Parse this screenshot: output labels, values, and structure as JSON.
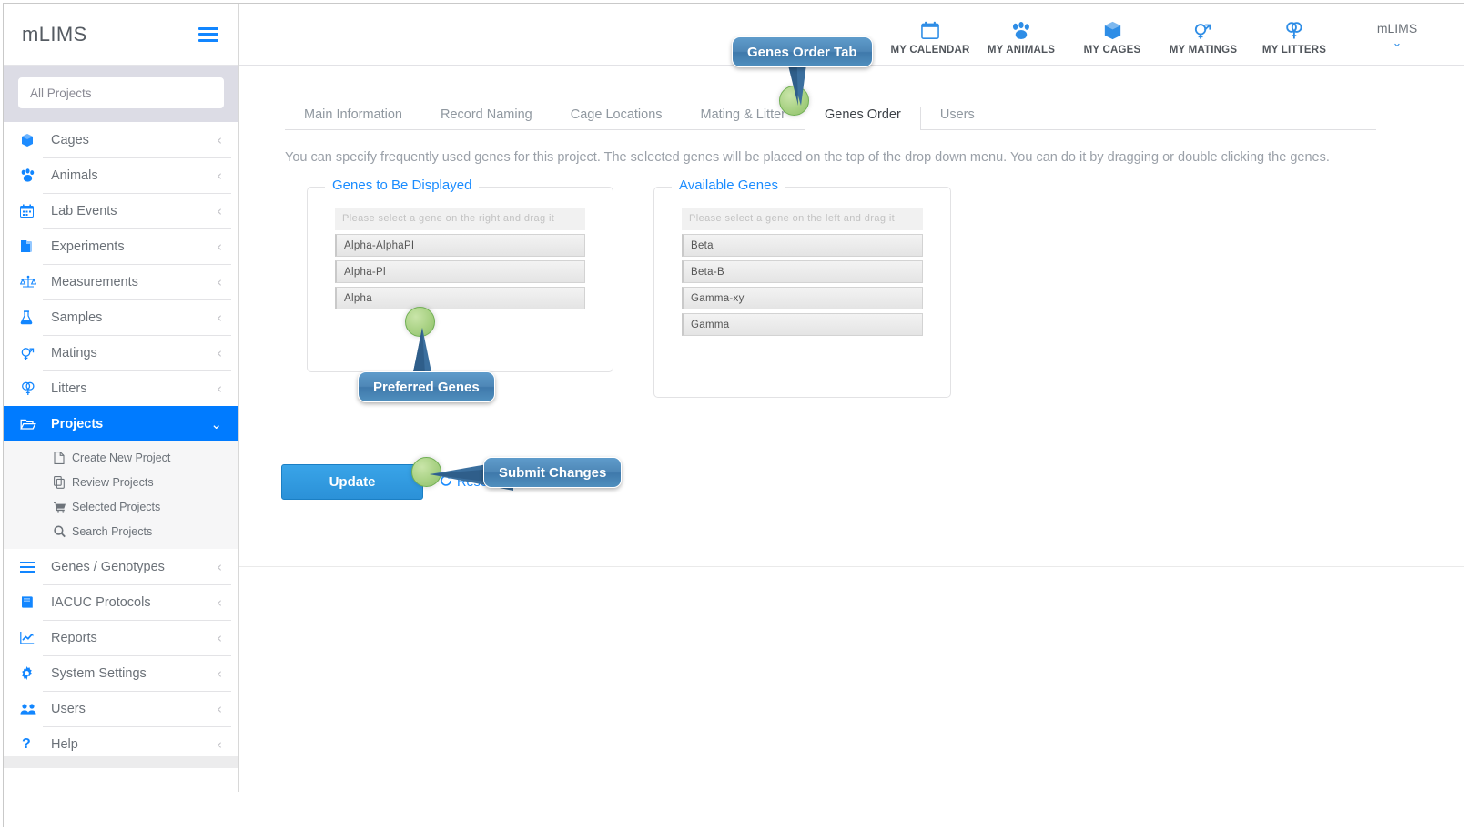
{
  "sidebar": {
    "brand": "mLIMS",
    "hamburger_icon": "hamburger-icon",
    "search": {
      "placeholder": "All Projects",
      "value": ""
    },
    "items": [
      {
        "label": "Cages",
        "icon": "cube-icon",
        "chevron": "‹"
      },
      {
        "label": "Animals",
        "icon": "paw-icon",
        "chevron": "‹"
      },
      {
        "label": "Lab Events",
        "icon": "calendar-icon",
        "chevron": "‹"
      },
      {
        "label": "Experiments",
        "icon": "documents-icon",
        "chevron": "‹"
      },
      {
        "label": "Measurements",
        "icon": "scales-icon",
        "chevron": "‹"
      },
      {
        "label": "Samples",
        "icon": "flask-icon",
        "chevron": "‹"
      },
      {
        "label": "Matings",
        "icon": "mating-icon",
        "chevron": "‹"
      },
      {
        "label": "Litters",
        "icon": "litters-icon",
        "chevron": "‹"
      },
      {
        "label": "Projects",
        "icon": "folder-open-icon",
        "chevron": "⌄",
        "active": true
      },
      {
        "label": "Genes / Genotypes",
        "icon": "list-icon",
        "chevron": "‹"
      },
      {
        "label": "IACUC Protocols",
        "icon": "book-icon",
        "chevron": "‹"
      },
      {
        "label": "Reports",
        "icon": "chart-line-icon",
        "chevron": "‹"
      },
      {
        "label": "System Settings",
        "icon": "gear-icon",
        "chevron": "‹"
      },
      {
        "label": "Users",
        "icon": "users-icon",
        "chevron": "‹"
      },
      {
        "label": "Help",
        "icon": "question-icon",
        "chevron": "‹"
      }
    ],
    "subitems": [
      {
        "label": "Create New Project",
        "icon": "file-icon"
      },
      {
        "label": "Review Projects",
        "icon": "copy-icon"
      },
      {
        "label": "Selected Projects",
        "icon": "cart-icon"
      },
      {
        "label": "Search Projects",
        "icon": "search-icon"
      }
    ]
  },
  "topbar": {
    "items": [
      {
        "label": "MY CALENDAR",
        "icon": "calendar-icon"
      },
      {
        "label": "MY ANIMALS",
        "icon": "paw-icon"
      },
      {
        "label": "MY CAGES",
        "icon": "cube-icon"
      },
      {
        "label": "MY MATINGS",
        "icon": "mating-icon"
      },
      {
        "label": "MY LITTERS",
        "icon": "litters-icon"
      }
    ],
    "user": {
      "name": "mLIMS",
      "caret": "⌄"
    }
  },
  "main": {
    "tabs": [
      {
        "label": "Main Information",
        "active": false
      },
      {
        "label": "Record Naming",
        "active": false
      },
      {
        "label": "Cage Locations",
        "active": false
      },
      {
        "label": "Mating & Litter",
        "active": false
      },
      {
        "label": "Genes Order",
        "active": true
      },
      {
        "label": "Users",
        "active": false
      }
    ],
    "description": "You can specify frequently used genes for this project. The selected genes will be placed on the top of the drop down menu. You can do it by dragging or double clicking the genes.",
    "left_panel": {
      "legend": "Genes to Be Displayed",
      "drop_hint": "Please select a gene on the right and drag it here.",
      "genes": [
        "Alpha-AlphaPI",
        "Alpha-Pl",
        "Alpha"
      ]
    },
    "right_panel": {
      "legend": "Available Genes",
      "drop_hint": "Please select a gene on the left and drag it here.",
      "genes": [
        "Beta",
        "Beta-B",
        "Gamma-xy",
        "Gamma"
      ]
    },
    "update_button": "Update",
    "reset_link": "Reset",
    "reset_icon": "refresh-icon"
  },
  "callouts": [
    {
      "label": "Genes Order Tab"
    },
    {
      "label": "Preferred Genes"
    },
    {
      "label": "Submit Changes"
    }
  ],
  "colors": {
    "accent_blue": "#007bff",
    "icon_blue": "#1286ff",
    "legend_blue": "#1a8cff",
    "callout_blue": "#4e87b7",
    "dot_green": "#a8d183",
    "search_band": "#dcdce5",
    "text_gray": "#6b7178",
    "muted_gray": "#9aa0a8"
  }
}
